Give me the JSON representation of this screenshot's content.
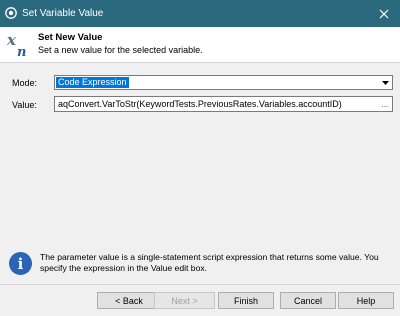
{
  "window": {
    "title": "Set Variable Value",
    "close_glyph": "✕"
  },
  "header": {
    "title": "Set New Value",
    "subtitle": "Set a new value for the selected variable."
  },
  "form": {
    "mode_label": "Mode:",
    "mode_value": "Code Expression",
    "value_label": "Value:",
    "value_text": "aqConvert.VarToStr(KeywordTests.PreviousRates.Variables.accountID)",
    "ellipsis_button": "..."
  },
  "info": {
    "icon_glyph": "i",
    "text": "The parameter value is a single-statement script expression that returns some value. You specify the expression in the Value edit box."
  },
  "buttons": {
    "back": "< Back",
    "next": "Next >",
    "finish": "Finish",
    "cancel": "Cancel",
    "help": "Help"
  },
  "colors": {
    "titlebar": "#2b6a7e",
    "selection": "#0078d7",
    "info_icon": "#2b64b5"
  }
}
